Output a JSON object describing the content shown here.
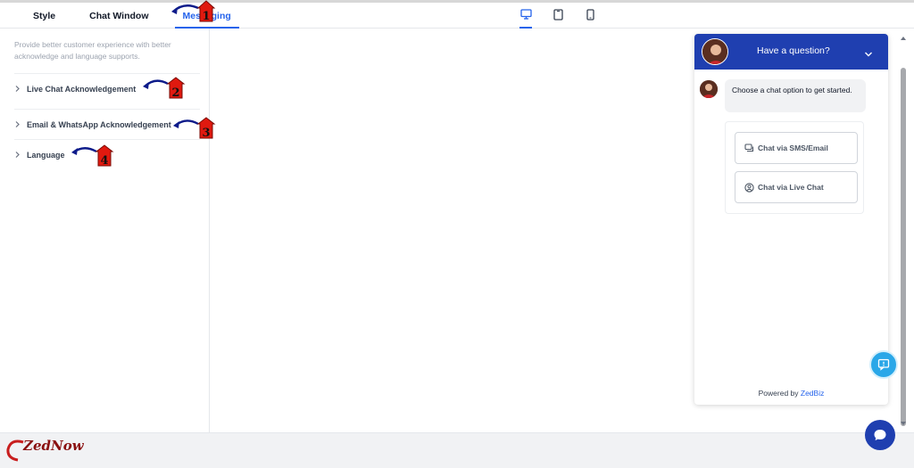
{
  "tabs": [
    {
      "label": "Style",
      "active": false
    },
    {
      "label": "Chat Window",
      "active": false
    },
    {
      "label": "Messaging",
      "active": true
    }
  ],
  "devices": [
    {
      "icon": "desktop-icon",
      "active": true
    },
    {
      "icon": "tablet-icon",
      "active": false
    },
    {
      "icon": "mobile-icon",
      "active": false
    }
  ],
  "panel": {
    "description": "Provide better customer experience with better acknowledge and language supports.",
    "sections": [
      {
        "label": "Live Chat Acknowledgement"
      },
      {
        "label": "Email & WhatsApp Acknowledgement"
      },
      {
        "label": "Language"
      }
    ]
  },
  "annotations": [
    "1",
    "2",
    "3",
    "4"
  ],
  "widget": {
    "header_title": "Have a question?",
    "greeting": "Choose a chat option to get started.",
    "options": [
      {
        "label": "Chat via SMS/Email",
        "icon": "chat-bubble-icon"
      },
      {
        "label": "Chat via Live Chat",
        "icon": "user-circle-icon"
      }
    ],
    "powered_prefix": "Powered by",
    "powered_brand": "ZedBiz"
  },
  "logo": {
    "text": "ZedNow"
  },
  "colors": {
    "accent": "#2563eb",
    "header_blue": "#1f3fb0",
    "annotation_red": "#e0190f",
    "annotation_arrow": "#0d1b8a",
    "feedback_blue": "#2aa7e8"
  }
}
